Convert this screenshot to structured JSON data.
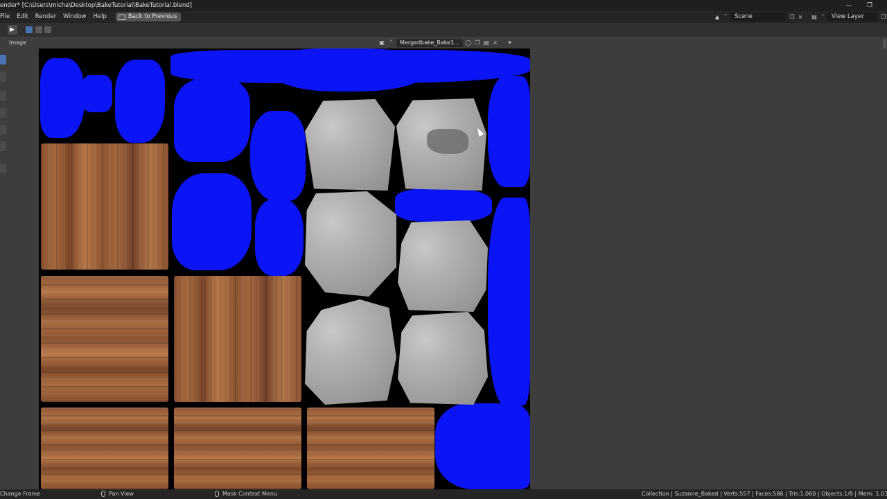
{
  "window": {
    "title": "ender* [C:\\Users\\micha\\Desktop\\BakeTutorial\\BakeTutorial.blend]",
    "minimize_icon": "minimize-icon",
    "restore_icon": "restore-icon"
  },
  "menu": {
    "items": [
      "File",
      "Edit",
      "Render",
      "Window",
      "Help"
    ],
    "back_button": "Back to Previous",
    "scene": "Scene",
    "view_layer": "View Layer"
  },
  "editor": {
    "panel_label": "Image",
    "image_name": "Mergedbake_Bake1...",
    "accent": "#4772b3"
  },
  "canvas": {
    "colors": {
      "background": "#000000",
      "bake_fill": "#0a14f5",
      "wood": "#a56a3f",
      "stone": "#b2b2b2"
    }
  },
  "status": {
    "left": "Change Frame",
    "middle": "Pan View",
    "right_ctx": "Mask Context Menu",
    "stats": "Collection | Suzanne_Baked | Verts:557 | Faces:586 | Tris:1,060 | Objects:1/8 | Mem: 1.03 GiB | 2.83.0"
  }
}
